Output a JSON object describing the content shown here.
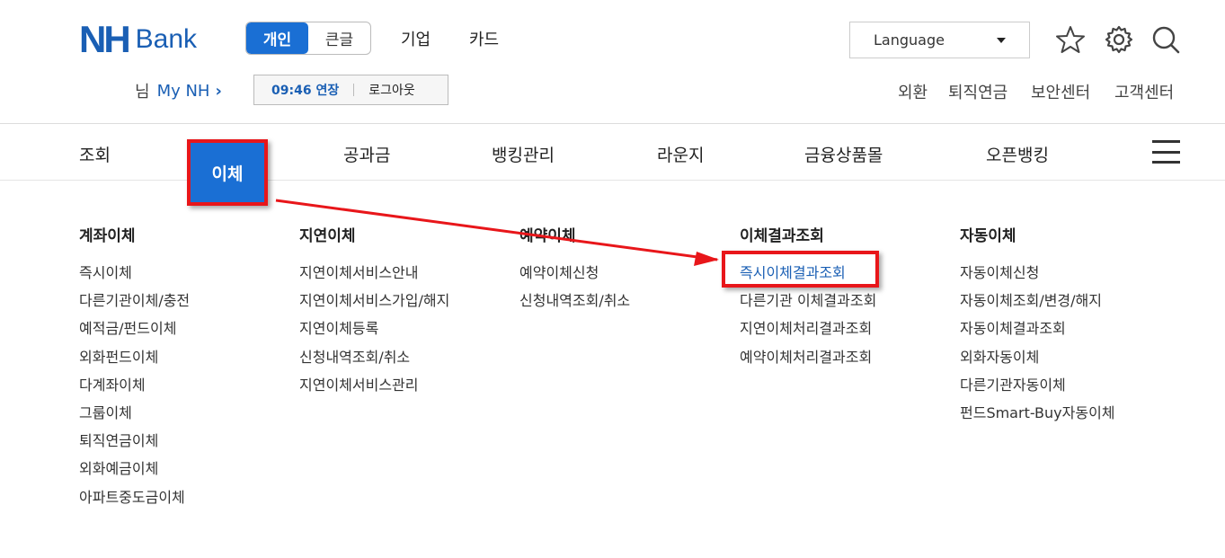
{
  "header": {
    "logo_nh": "NH",
    "logo_bank": "Bank",
    "segment": {
      "personal": "개인",
      "large": "큰글"
    },
    "links": [
      "기업",
      "카드"
    ],
    "language": "Language",
    "icons": [
      "star-icon",
      "gear-icon",
      "search-icon"
    ]
  },
  "user": {
    "honorific": "님",
    "my_nh": "My NH",
    "chevron": "›"
  },
  "session": {
    "time_extend": "09:46 연장",
    "logout": "로그아웃"
  },
  "utility_links": [
    "외환",
    "퇴직연금",
    "보안센터",
    "고객센터"
  ],
  "gnb": {
    "items": [
      "조회",
      "이체",
      "공과금",
      "뱅킹관리",
      "라운지",
      "금융상품몰",
      "오픈뱅킹"
    ],
    "active": "이체"
  },
  "menu": {
    "columns": [
      {
        "title": "계좌이체",
        "items": [
          "즉시이체",
          "다른기관이체/충전",
          "예적금/펀드이체",
          "외화펀드이체",
          "다계좌이체",
          "그룹이체",
          "퇴직연금이체",
          "외화예금이체",
          "아파트중도금이체"
        ]
      },
      {
        "title": "지연이체",
        "items": [
          "지연이체서비스안내",
          "지연이체서비스가입/해지",
          "지연이체등록",
          "신청내역조회/취소",
          "지연이체서비스관리"
        ]
      },
      {
        "title": "예약이체",
        "items": [
          "예약이체신청",
          "신청내역조회/취소"
        ]
      },
      {
        "title": "이체결과조회",
        "items": [
          "즉시이체결과조회",
          "다른기관 이체결과조회",
          "지연이체처리결과조회",
          "예약이체처리결과조회"
        ]
      },
      {
        "title": "자동이체",
        "items": [
          "자동이체신청",
          "자동이체조회/변경/해지",
          "자동이체결과조회",
          "외화자동이체",
          "다른기관자동이체",
          "펀드Smart-Buy자동이체"
        ]
      }
    ],
    "highlighted": "즉시이체결과조회"
  },
  "colors": {
    "brand": "#1a5fb4",
    "accent": "#1a6fd4",
    "annotation": "#e8161a"
  }
}
